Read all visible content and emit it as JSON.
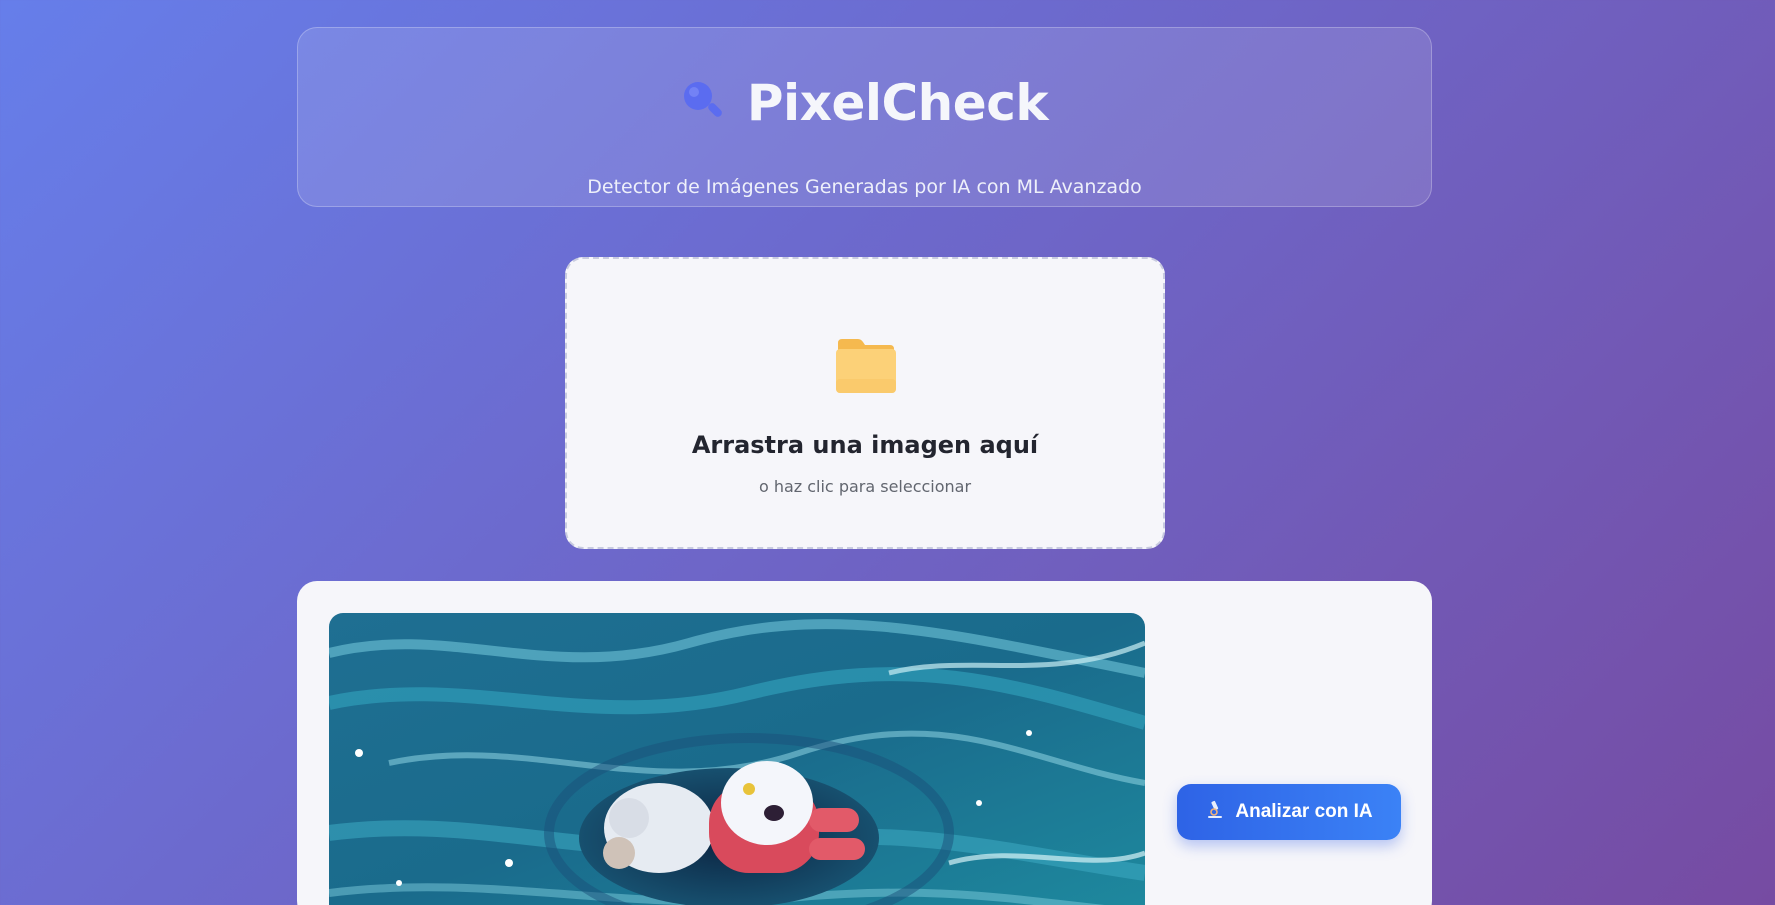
{
  "header": {
    "title": "PixelCheck",
    "subtitle": "Detector de Imágenes Generadas por IA con ML Avanzado",
    "logo_icon": "magnifier-icon"
  },
  "upload": {
    "icon": "folder-icon",
    "title": "Arrastra una imagen aquí",
    "hint": "o haz clic para seleccionar"
  },
  "preview": {
    "analyze_label": "Analizar con IA",
    "analyze_icon": "microscope-icon"
  },
  "colors": {
    "bg_start": "#667eea",
    "bg_end": "#764ba2",
    "accent": "#3b6fe8",
    "folder": "#fcc96b"
  }
}
